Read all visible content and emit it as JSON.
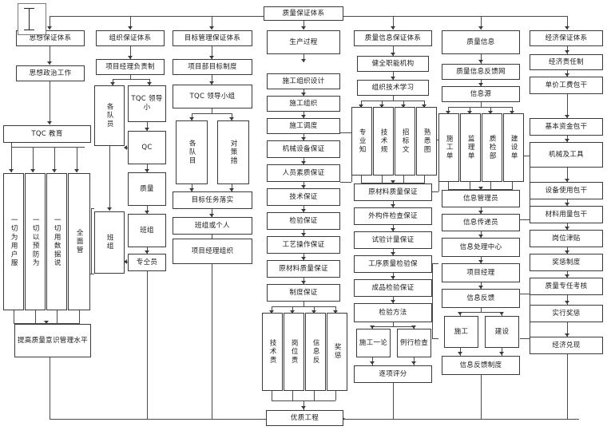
{
  "diagram": {
    "title": "质量保证体系",
    "root": "质量保证体系",
    "footer": "优质工程",
    "columns": [
      {
        "id": "ideology",
        "head": "思想保证体系",
        "nodes": [
          "思想政治工作",
          "TQC 教育"
        ],
        "vertical": [
          "一切为用户服",
          "一切以预防为",
          "一切用数据说",
          "全面管"
        ],
        "tail": [
          "提高质量意识管理水平"
        ]
      },
      {
        "id": "organization",
        "head": "组织保证体系",
        "nodes": [
          "项目经理负责制"
        ],
        "vertical": [
          "各队员",
          "班组"
        ],
        "chain": [
          "TQC 领导小",
          "QC",
          "质量",
          "班组",
          "专仝员"
        ]
      },
      {
        "id": "target",
        "head": "目标管理保证体系",
        "nodes": [
          "项目部目标制度",
          "TQC 领导小组"
        ],
        "vertical": [
          "各队目",
          "对策措"
        ],
        "tail": [
          "目标任务落实",
          "班组或个人",
          "项目经理组织"
        ]
      },
      {
        "id": "production",
        "head": "生产过程",
        "nodes": [
          "施工组织设计",
          "施工组织",
          "施工调度",
          "机械设备保证",
          "人员素质保证",
          "技术保证",
          "检验保证",
          "工艺操作保证",
          "原材料质量保证",
          "制度保证"
        ],
        "vertical": [
          "技术责",
          "岗位责",
          "信息反",
          "奖惩"
        ]
      },
      {
        "id": "info-assurance",
        "head": "质量信息保证体系",
        "nodes": [
          "健全职能机构",
          "组织技术学习"
        ],
        "vertical": [
          "专业知",
          "技术规",
          "招标文",
          "熟悉图"
        ],
        "tail": [
          "原材料质量保证",
          "外构件检查保证",
          "试验计量保证",
          "工序质量检验保",
          "成品检验保证",
          "检验方法"
        ],
        "pair": [
          "施工一论",
          "例行检查"
        ],
        "last": "逐项评分"
      },
      {
        "id": "quality-info",
        "head": "质量信息",
        "nodes": [
          "质量信息反馈网",
          "信息源"
        ],
        "vertical": [
          "施工单",
          "监理单",
          "质检部",
          "建设单"
        ],
        "tail": [
          "信息管理员",
          "信息传递员",
          "信息处理中心",
          "项目经理",
          "信息反馈"
        ],
        "pair": [
          "施工",
          "建设"
        ],
        "last": "信息反馈制度"
      },
      {
        "id": "economic",
        "head": "经济保证体系",
        "nodes": [
          "经济责任制",
          "单价工费包干",
          "基本资金包干",
          "机械及工具",
          "设备使用包干",
          "材料用量包干",
          "岗位津贴",
          "奖惩制度",
          "质量专任考核",
          "实行奖惩",
          "经济兑现"
        ]
      }
    ]
  },
  "cursor": {
    "name": "text-cursor"
  }
}
